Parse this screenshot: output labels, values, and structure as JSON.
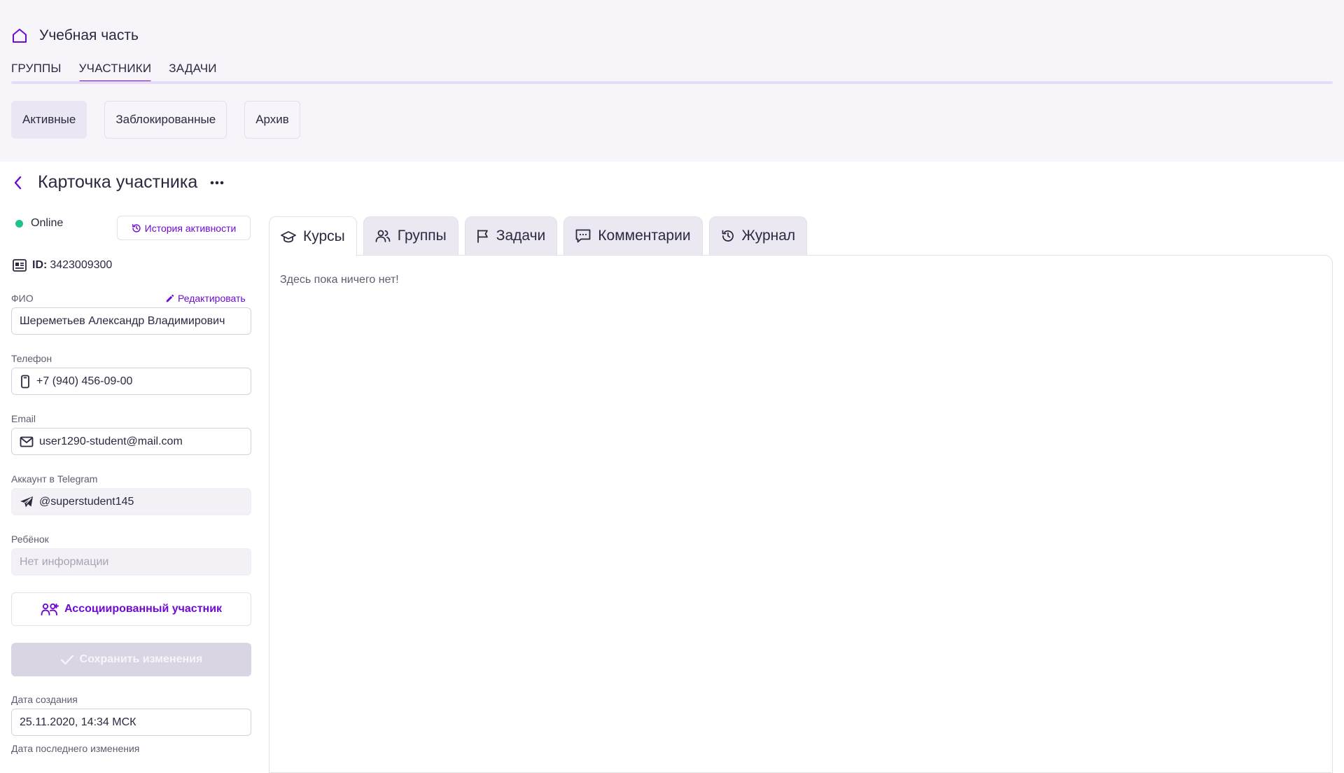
{
  "app": {
    "title": "Учебная часть",
    "icon": "home-icon",
    "accent_color": "#6f0bd0"
  },
  "nav": {
    "tabs": [
      {
        "label": "ГРУППЫ",
        "active": false
      },
      {
        "label": "УЧАСТНИКИ",
        "active": true
      },
      {
        "label": "ЗАДАЧИ",
        "active": false
      }
    ]
  },
  "subtabs": [
    {
      "label": "Активные",
      "active": true
    },
    {
      "label": "Заблокированные",
      "active": false
    },
    {
      "label": "Архив",
      "active": false
    }
  ],
  "card": {
    "title": "Карточка участника",
    "status_text": "Online",
    "status_color": "#1ec486",
    "history_button": "История активности",
    "id_label": "ID:",
    "id_value": "3423009300"
  },
  "form": {
    "fio": {
      "label": "ФИО",
      "value": "Шереметьев Александр Владимирович",
      "edit_label": "Редактировать"
    },
    "phone": {
      "label": "Телефон",
      "value": "+7 (940) 456-09-00",
      "icon": "phone-icon"
    },
    "email": {
      "label": "Email",
      "value": "user1290-student@mail.com",
      "icon": "mail-icon"
    },
    "telegram": {
      "label": "Аккаунт в Telegram",
      "value": "@superstudent145",
      "icon": "telegram-icon"
    },
    "child": {
      "label": "Ребёнок",
      "placeholder": "Нет информации"
    },
    "associated_button": "Ассоциированный участник",
    "save_button": "Сохранить изменения",
    "created": {
      "label": "Дата создания",
      "value": "25.11.2020, 14:34 МСК"
    },
    "modified": {
      "label": "Дата последнего изменения"
    }
  },
  "panel": {
    "tabs": [
      {
        "label": "Курсы",
        "icon": "graduation-cap-icon",
        "active": true
      },
      {
        "label": "Группы",
        "icon": "users-icon",
        "active": false
      },
      {
        "label": "Задачи",
        "icon": "flag-icon",
        "active": false
      },
      {
        "label": "Комментарии",
        "icon": "comment-icon",
        "active": false
      },
      {
        "label": "Журнал",
        "icon": "history-icon",
        "active": false
      }
    ],
    "empty_text": "Здесь пока ничего нет!"
  }
}
